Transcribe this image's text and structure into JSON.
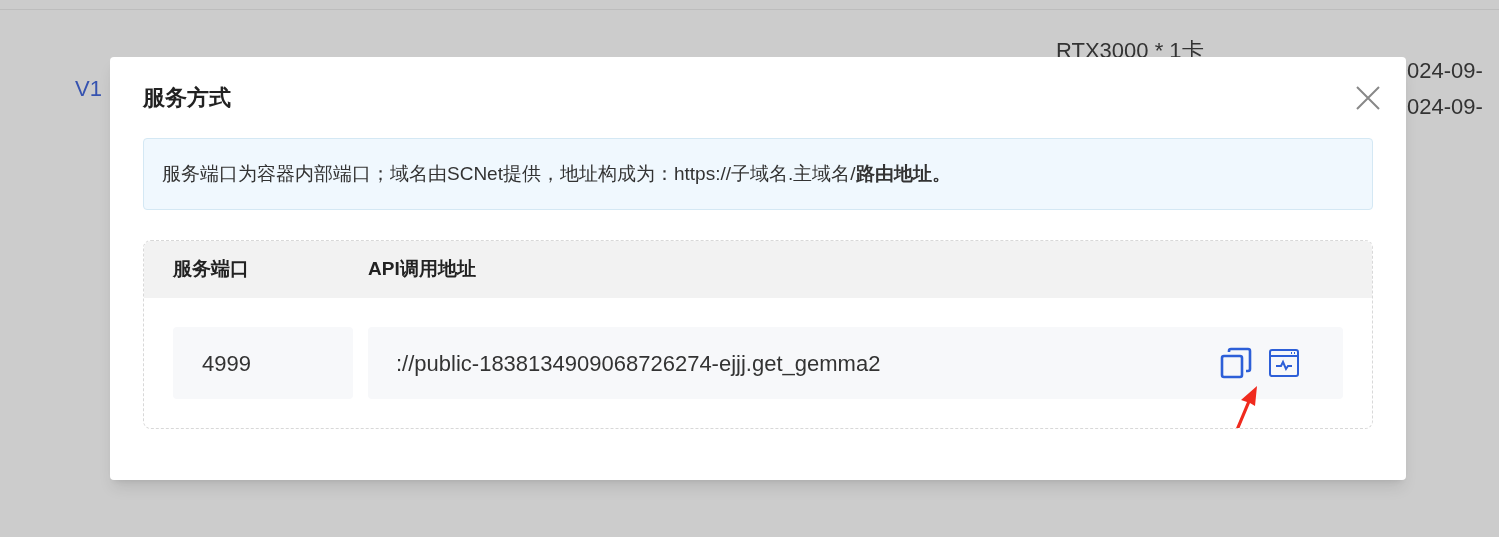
{
  "background": {
    "version_link": "V1",
    "gpu": "RTX3000 * 1卡",
    "dates": [
      "024-09-",
      "024-09-"
    ]
  },
  "dialog": {
    "title": "服务方式",
    "notice": "服务端口为容器内部端口；域名由SCNet提供，地址构成为：https://子域名.主域名/**路由地址。**",
    "table": {
      "columns": [
        "服务端口",
        "API调用地址"
      ],
      "rows": [
        {
          "port": "4999",
          "address": "://public-1838134909068726274-ejjj.get_gemma2"
        }
      ]
    }
  }
}
